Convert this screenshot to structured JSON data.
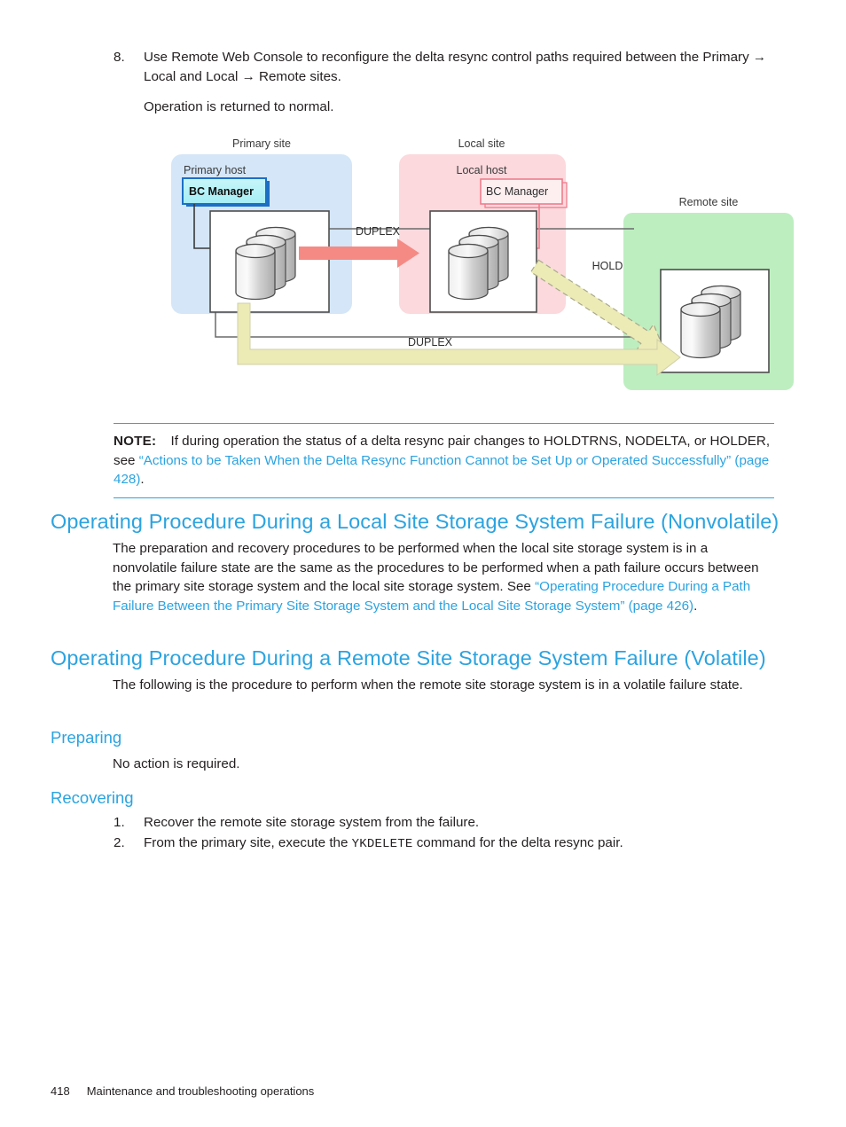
{
  "step8": {
    "number": "8.",
    "text": "Use Remote Web Console to reconfigure the delta resync control paths required between the Primary → Local and Local → Remote sites.",
    "result": "Operation is returned to normal."
  },
  "figure": {
    "sites": [
      {
        "id": "primary",
        "title": "Primary site",
        "host_label": "Primary host",
        "manager_label": "BC Manager",
        "fill": "#d4e6f7",
        "manager_fill": "#b3f0f6",
        "manager_border": "#1c6fc4"
      },
      {
        "id": "local",
        "title": "Local site",
        "host_label": "Local host",
        "manager_label": "BC Manager",
        "fill": "#fbd9dd",
        "manager_fill": "#fdeff0",
        "manager_border": "#f07c8c"
      },
      {
        "id": "remote",
        "title": "Remote site",
        "fill": "#bdeec0"
      }
    ],
    "arrows": [
      {
        "id": "primary-to-local",
        "label": "DUPLEX",
        "color": "#f58a85",
        "style": "solid"
      },
      {
        "id": "local-to-remote",
        "label": "HOLD",
        "color": "#ecebb6",
        "style": "dashed"
      },
      {
        "id": "primary-to-remote",
        "label": "DUPLEX",
        "color": "#ecebb6",
        "style": "solid"
      }
    ]
  },
  "note": {
    "label": "NOTE:",
    "text_1": "If during operation the status of a delta resync pair changes to HOLDTRNS, NODELTA, or HOLDER, see ",
    "link": "“Actions to be Taken When the Delta Resync Function Cannot be Set Up or Operated Successfully” (page 428)",
    "text_2": "."
  },
  "section_nonvolatile": {
    "heading": "Operating Procedure During a Local Site Storage System Failure (Nonvolatile)",
    "para_1": "The preparation and recovery procedures to be performed when the local site storage system is in a nonvolatile failure state are the same as the procedures to be performed when a path failure occurs between the primary site storage system and the local site storage system. See ",
    "link": "“Operating Procedure During a Path Failure Between the Primary Site Storage System and the Local Site Storage System” (page 426)",
    "para_2": "."
  },
  "section_volatile": {
    "heading": "Operating Procedure During a Remote Site Storage System Failure (Volatile)",
    "para": "The following is the procedure to perform when the remote site storage system is in a volatile failure state.",
    "preparing": {
      "heading": "Preparing",
      "text": "No action is required."
    },
    "recovering": {
      "heading": "Recovering",
      "items": [
        {
          "num": "1.",
          "pre": "Recover the remote site storage system from the failure.",
          "code": "",
          "post": ""
        },
        {
          "num": "2.",
          "pre": "From the primary site, execute the ",
          "code": "YKDELETE",
          "post": " command for the delta resync pair."
        }
      ]
    }
  },
  "footer": {
    "page_number": "418",
    "chapter": "Maintenance and troubleshooting operations"
  },
  "colors": {
    "link": "#2ba3e0",
    "text": "#231f20"
  }
}
